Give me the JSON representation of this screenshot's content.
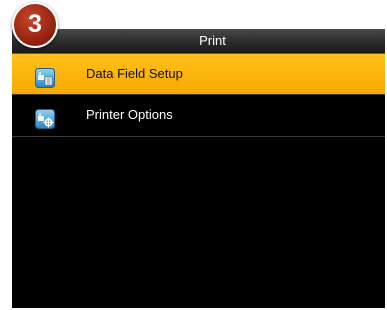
{
  "step_badge": {
    "number": "3",
    "color": "#9a2b12"
  },
  "header": {
    "title": "Print"
  },
  "menu": {
    "items": [
      {
        "label": "Data Field Setup",
        "icon": "data-field-setup-icon",
        "selected": true
      },
      {
        "label": "Printer Options",
        "icon": "printer-options-icon",
        "selected": false
      }
    ]
  },
  "colors": {
    "highlight": "#f5a800",
    "background": "#000000",
    "text": "#ffffff"
  }
}
